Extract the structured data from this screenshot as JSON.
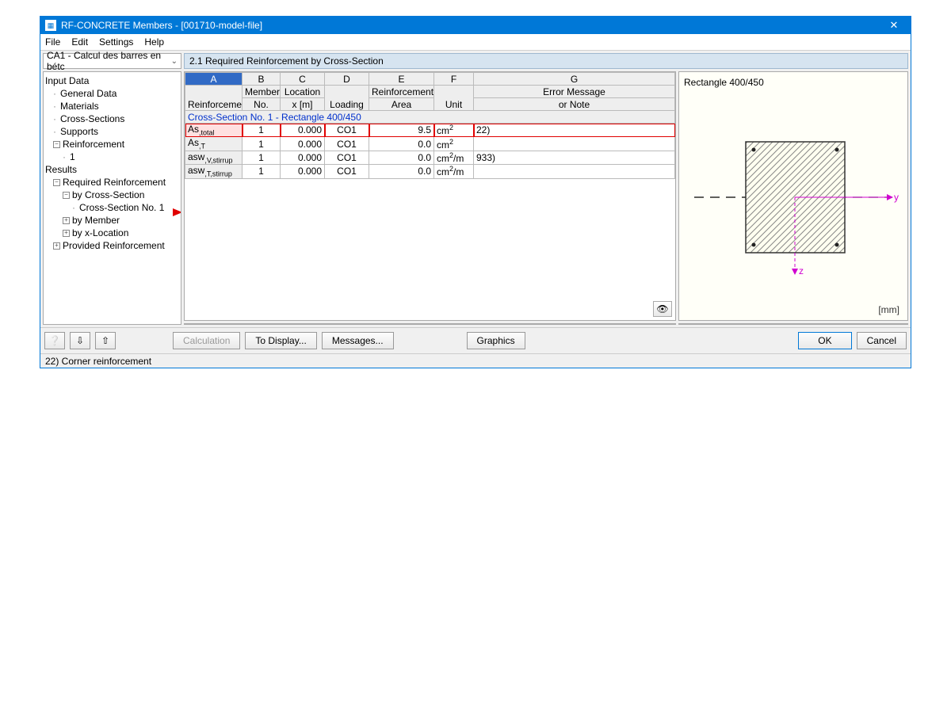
{
  "window": {
    "title": "RF-CONCRETE Members - [001710-model-file]"
  },
  "menu": {
    "file": "File",
    "edit": "Edit",
    "settings": "Settings",
    "help": "Help"
  },
  "combo": {
    "value": "CA1 - Calcul des barres en bétc"
  },
  "tree": {
    "input": "Input Data",
    "general": "General Data",
    "materials": "Materials",
    "cross": "Cross-Sections",
    "supports": "Supports",
    "reinforcement": "Reinforcement",
    "reinf1": "1",
    "results": "Results",
    "reqreinf": "Required Reinforcement",
    "bycross": "by Cross-Section",
    "cs1": "Cross-Section No. 1",
    "bymember": "by Member",
    "byxloc": "by x-Location",
    "provided": "Provided Reinforcement"
  },
  "panel": {
    "title": "2.1 Required Reinforcement by Cross-Section"
  },
  "columns": {
    "A": "A",
    "B": "B",
    "C": "C",
    "D": "D",
    "E": "E",
    "F": "F",
    "G": "G",
    "reinf": "Reinforcement",
    "member": "Member",
    "no": "No.",
    "location": "Location",
    "xm": "x [m]",
    "loading": "Loading",
    "reinfarea": "Reinforcement",
    "area": "Area",
    "unit": "Unit",
    "error": "Error Message",
    "note": "or Note"
  },
  "section_header": "Cross-Section No. 1 - Rectangle 400/450",
  "rows": [
    {
      "label": "As,total",
      "member": "1",
      "x": "0.000",
      "load": "CO1",
      "area": "9.5",
      "unit": "cm²",
      "note": "22)",
      "hl": true
    },
    {
      "label": "As,T",
      "member": "1",
      "x": "0.000",
      "load": "CO1",
      "area": "0.0",
      "unit": "cm²",
      "note": ""
    },
    {
      "label": "asw,V,stirrup",
      "member": "1",
      "x": "0.000",
      "load": "CO1",
      "area": "0.0",
      "unit": "cm²/m",
      "note": "933)"
    },
    {
      "label": "asw,T,stirrup",
      "member": "1",
      "x": "0.000",
      "load": "CO1",
      "area": "0.0",
      "unit": "cm²/m",
      "note": ""
    }
  ],
  "preview": {
    "title": "Rectangle 400/450",
    "unit": "[mm]",
    "y": "y",
    "z": "z"
  },
  "buttons": {
    "calc": "Calculation",
    "display": "To Display...",
    "messages": "Messages...",
    "graphics": "Graphics",
    "ok": "OK",
    "cancel": "Cancel"
  },
  "status": "22) Corner reinforcement"
}
